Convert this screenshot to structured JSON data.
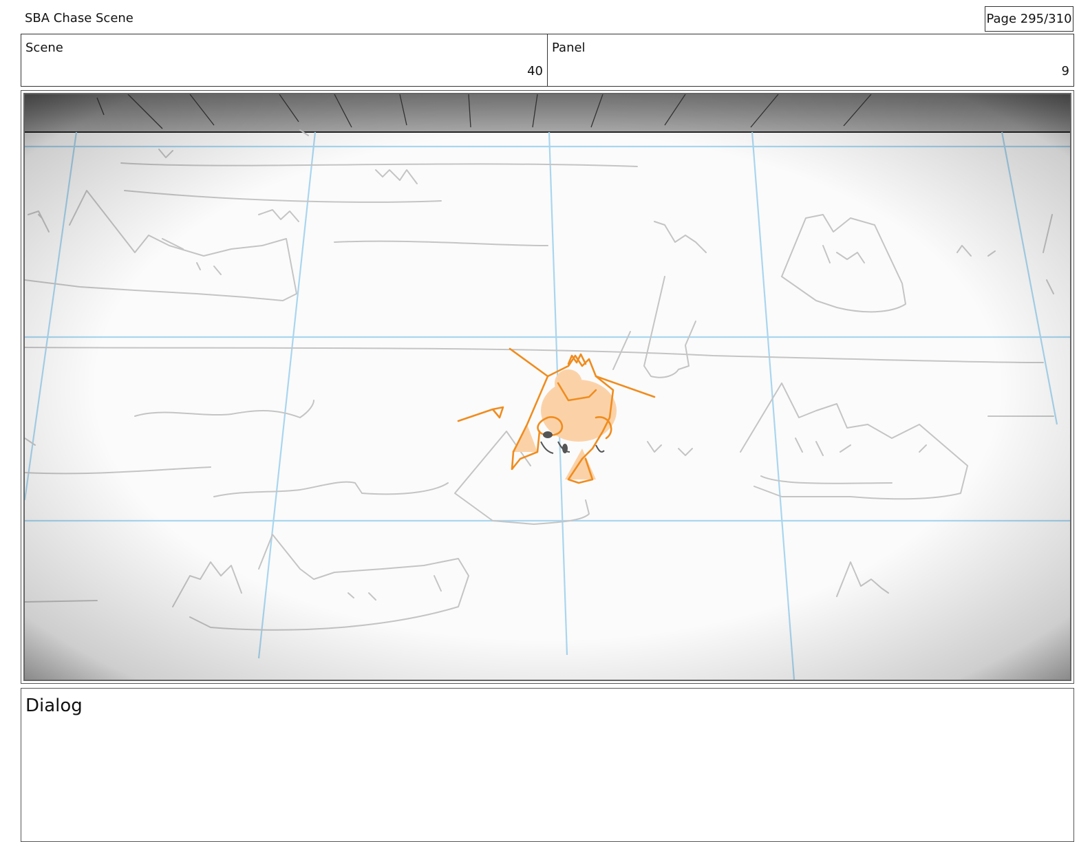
{
  "header": {
    "title": "SBA Chase Scene",
    "page": "Page 295/310"
  },
  "info": {
    "scene_label": "Scene",
    "scene_value": "40",
    "panel_label": "Panel",
    "panel_value": "9"
  },
  "panel_image": {
    "description_icon": "storyboard-sketch",
    "sketch_color": "#c4c4c4",
    "guide_color": "#a9d6ef",
    "character_color": "#f08c1e",
    "character_fill": "#fbd2a8"
  },
  "dialog": {
    "label": "Dialog",
    "text": ""
  }
}
